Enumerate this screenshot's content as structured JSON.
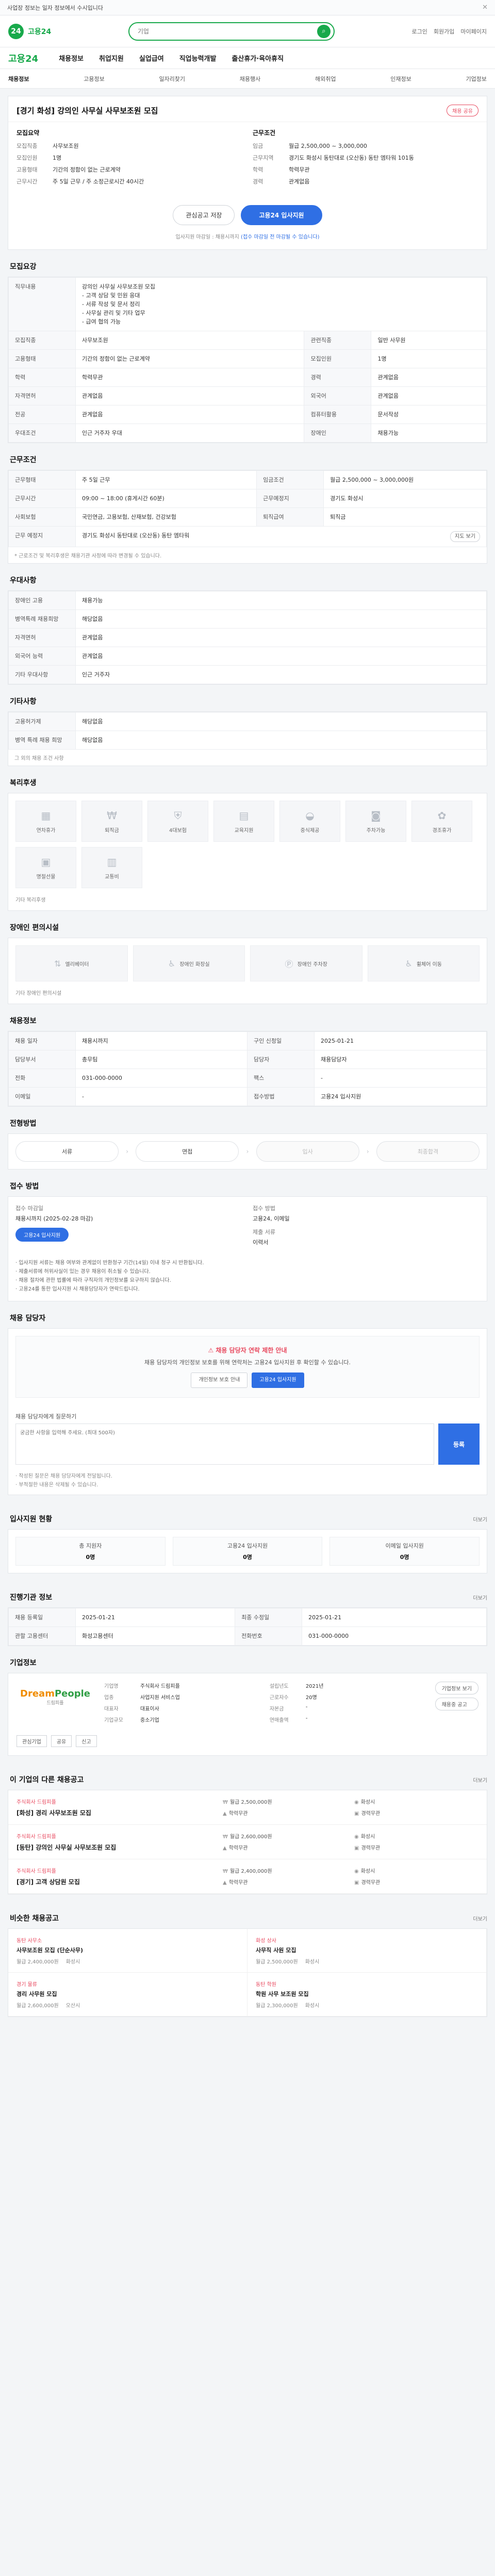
{
  "topbar": {
    "text": "사업장 정보는 일자 정보에서 수시입니다"
  },
  "header": {
    "logo_mark": "24",
    "logo_name": "고용24",
    "search_placeholder": "기업",
    "links": [
      "로그인",
      "회원가입",
      "마이페이지"
    ]
  },
  "gnb": {
    "brand": "고용24",
    "menus": [
      "채용정보",
      "취업지원",
      "실업급여",
      "직업능력개발",
      "출산휴가·육아휴직"
    ]
  },
  "subnav": [
    "채용정보",
    "고용정보",
    "일자리찾기",
    "채용행사",
    "해외취업",
    "인재정보",
    "기업정보"
  ],
  "job": {
    "title": "[경기 화성] 강의인 사무실 사무보조원 모집",
    "share": "채용 공유",
    "left_head": "모집요약",
    "left_rows": [
      {
        "k": "모집직종",
        "v": "사무보조원"
      },
      {
        "k": "모집인원",
        "v": "1명"
      },
      {
        "k": "고용형태",
        "v": "기간의 정함이 없는 근로계약"
      },
      {
        "k": "근무시간",
        "v": "주 5일 근무 / 주 소정근로시간 40시간"
      }
    ],
    "right_head": "근무조건",
    "right_rows": [
      {
        "k": "임금",
        "v": "월급 2,500,000 ~ 3,000,000"
      },
      {
        "k": "근무지역",
        "v": "경기도 화성시 동탄대로 (오산동) 동탄 엠타워 101동"
      },
      {
        "k": "학력",
        "v": "학력무관"
      },
      {
        "k": "경력",
        "v": "관계없음"
      }
    ],
    "save_btn": "관심공고 저장",
    "apply_btn": "고용24 입사지원",
    "notice_a": "입사지원 마감일 : 채용시까지 ",
    "notice_b": "(접수 마감일 전 마감될 수 있습니다)"
  },
  "sec_recruit": {
    "title": "모집요강",
    "duty_label": "직무내용",
    "duty_lines": [
      "강의인 사무실 사무보조원 모집",
      "- 고객 상담 및 민원 응대",
      "- 서류 작성 및 문서 정리",
      "- 사무실 관리 및 기타 업무",
      "- 급여 협의 가능"
    ],
    "rows": [
      {
        "k": "모집직종",
        "v": "사무보조원",
        "k2": "관련직종",
        "v2": "일반 사무원"
      },
      {
        "k": "고용형태",
        "v": "기간의 정함이 없는 근로계약",
        "k2": "모집인원",
        "v2": "1명"
      },
      {
        "k": "학력",
        "v": "학력무관",
        "k2": "경력",
        "v2": "관계없음"
      },
      {
        "k": "자격면허",
        "v": "관계없음",
        "k2": "외국어",
        "v2": "관계없음"
      },
      {
        "k": "전공",
        "v": "관계없음",
        "k2": "컴퓨터활용",
        "v2": "문서작성"
      },
      {
        "k": "우대조건",
        "v": "인근 거주자 우대",
        "k2": "장애인",
        "v2": "채용가능"
      }
    ]
  },
  "sec_work": {
    "title": "근무조건",
    "rows": [
      {
        "k": "근무형태",
        "v": "주 5일 근무",
        "k2": "임금조건",
        "v2": "월급 2,500,000 ~ 3,000,000원"
      },
      {
        "k": "근무시간",
        "v": "09:00 ~ 18:00 (휴게시간 60분)",
        "k2": "근무예정지",
        "v2": "경기도 화성시"
      },
      {
        "k": "사회보험",
        "v": "국민연금, 고용보험, 산재보험, 건강보험",
        "k2": "퇴직급여",
        "v2": "퇴직금"
      },
      {
        "k": "근무 예정지",
        "v": "경기도 화성시 동탄대로 (오산동) 동탄 엠타워",
        "k2": "",
        "v2": ""
      }
    ],
    "map_btn": "지도 보기",
    "note": "* 근로조건 및 복리후생은 채용기관 사정에 따라 변경될 수 있습니다."
  },
  "sec_apply": {
    "title": "우대사항",
    "rows": [
      {
        "k": "장애인 고용",
        "v": "채용가능"
      },
      {
        "k": "병역특례 채용희망",
        "v": "해당없음"
      },
      {
        "k": "자격면허",
        "v": "관계없음"
      },
      {
        "k": "외국어 능력",
        "v": "관계없음"
      },
      {
        "k": "기타 우대사항",
        "v": "인근 거주자"
      }
    ]
  },
  "sec_etc": {
    "title": "기타사항",
    "rows": [
      {
        "k": "고용허가제",
        "v": "해당없음"
      },
      {
        "k": "병역 특례 채용 희망",
        "v": "해당없음"
      }
    ],
    "note": "그 외의 채용 조건 사항"
  },
  "sec_welfare": {
    "title": "복리후생",
    "tiles": [
      "연차휴가",
      "퇴직금",
      "4대보험",
      "교육지원",
      "중식제공",
      "주차가능",
      "경조휴가",
      "명절선물",
      "교통비"
    ],
    "note": "기타 복리후생"
  },
  "sec_disabled": {
    "title": "장애인 편의시설",
    "tiles": [
      "엘리베이터",
      "장애인 화장실",
      "장애인 주차장",
      "휠체어 이동"
    ],
    "note": "기타 장애인 편의시설"
  },
  "sec_corp_info": {
    "title": "채용정보",
    "rows": [
      {
        "k": "채용 일자",
        "v": "채용시까지",
        "k2": "구인 신청일",
        "v2": "2025-01-21"
      },
      {
        "k": "담당부서",
        "v": "총무팀",
        "k2": "담당자",
        "v2": "채용담당자"
      },
      {
        "k": "전화",
        "v": "031-000-0000",
        "k2": "팩스",
        "v2": "-"
      },
      {
        "k": "이메일",
        "v": "-",
        "k2": "접수방법",
        "v2": "고용24 입사지원"
      }
    ]
  },
  "sec_process": {
    "title": "전형방법",
    "steps": [
      "서류",
      "면접",
      "입사",
      "최종합격"
    ]
  },
  "sec_docs": {
    "title": "접수 방법",
    "col1_label": "접수 마감일",
    "col1_val": "채용시까지 (2025-02-28 마감)",
    "col2_label": "접수 방법",
    "col2_val": "고용24, 이메일",
    "col3_label": "제출 서류",
    "col3_val": "이력서",
    "apply_btn": "고용24 입사지원",
    "bullets": [
      "· 입사지원 서류는 채용 여부와 관계없이 반환청구 기간(14일) 이내 청구 시 반환됩니다.",
      "· 제출서류에 허위사실이 있는 경우 채용이 취소될 수 있습니다.",
      "· 채용 절차에 관한 법률에 따라 구직자의 개인정보를 요구하지 않습니다.",
      "· 고용24를 통한 입사지원 시 채용담당자가 연락드립니다."
    ]
  },
  "sec_contact": {
    "title": "채용 담당자",
    "warn_title": "채용 담당자 연락 제한 안내",
    "warn_text": "채용 담당자의 개인정보 보호를 위해 연락처는 고용24 입사지원 후 확인할 수 있습니다.",
    "btn1": "개인정보 보호 안내",
    "btn2": "고용24 입사지원",
    "qna_label": "채용 담당자에게 질문하기",
    "qna_placeholder": "궁금한 사항을 입력해 주세요. (최대 500자)",
    "qna_send": "등록",
    "qna_notes": [
      "· 작성된 질문은 채용 담당자에게 전달됩니다.",
      "· 부적절한 내용은 삭제될 수 있습니다."
    ]
  },
  "sec_stats": {
    "title": "입사지원 현황",
    "more": "더보기",
    "boxes": [
      {
        "label": "총 지원자",
        "num": "0명"
      },
      {
        "label": "고용24 입사지원",
        "num": "0명"
      },
      {
        "label": "이메일 입사지원",
        "num": "0명"
      }
    ]
  },
  "sec_history": {
    "title": "진행기관 정보",
    "more": "더보기",
    "rows": [
      {
        "k": "채용 등록일",
        "v": "2025-01-21",
        "k2": "최종 수정일",
        "v2": "2025-01-21"
      },
      {
        "k": "관할 고용센터",
        "v": "화성고용센터",
        "k2": "전화번호",
        "v2": "031-000-0000"
      }
    ]
  },
  "sec_company": {
    "title": "기업정보",
    "logo_a": "Dream",
    "logo_b": "People",
    "logo_sub": "드림피플",
    "col1": [
      {
        "k": "기업명",
        "v": "주식회사 드림피플"
      },
      {
        "k": "업종",
        "v": "사업지원 서비스업"
      },
      {
        "k": "대표자",
        "v": "대표이사"
      },
      {
        "k": "기업규모",
        "v": "중소기업"
      }
    ],
    "col2": [
      {
        "k": "설립년도",
        "v": "2021년"
      },
      {
        "k": "근로자수",
        "v": "20명"
      },
      {
        "k": "자본금",
        "v": "-"
      },
      {
        "k": "연매출액",
        "v": "-"
      }
    ],
    "btns": [
      "기업정보 보기",
      "채용중 공고"
    ],
    "small": [
      "관심기업",
      "공유",
      "신고"
    ]
  },
  "sec_other": {
    "title": "이 기업의 다른 채용공고",
    "more": "더보기",
    "jobs": [
      {
        "co": "주식회사 드림피플",
        "title": "[화성] 경리 사무보조원 모집",
        "a": "월급 2,500,000원",
        "b": "화성시",
        "c": "학력무관",
        "d": "경력무관"
      },
      {
        "co": "주식회사 드림피플",
        "title": "[동탄] 강의인 사무실 사무보조원 모집",
        "a": "월급 2,600,000원",
        "b": "화성시",
        "c": "학력무관",
        "d": "경력무관"
      },
      {
        "co": "주식회사 드림피플",
        "title": "[경기] 고객 상담원 모집",
        "a": "월급 2,400,000원",
        "b": "화성시",
        "c": "학력무관",
        "d": "경력무관"
      }
    ]
  },
  "sec_recommend": {
    "title": "비슷한 채용공고",
    "more": "더보기",
    "items": [
      {
        "co": "동탄 사무소",
        "title": "사무보조원 모집 (단순사무)",
        "m1": "월급 2,400,000원",
        "m2": "화성시"
      },
      {
        "co": "화성 상사",
        "title": "사무직 사원 모집",
        "m1": "월급 2,500,000원",
        "m2": "화성시"
      },
      {
        "co": "경기 물류",
        "title": "경리 사무원 모집",
        "m1": "월급 2,600,000원",
        "m2": "오산시"
      },
      {
        "co": "동탄 학원",
        "title": "학원 사무 보조원 모집",
        "m1": "월급 2,300,000원",
        "m2": "화성시"
      }
    ]
  }
}
